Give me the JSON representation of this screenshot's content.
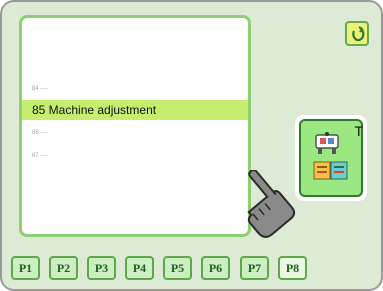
{
  "list": {
    "rows": [
      {
        "label": "84 ----"
      },
      {
        "label": "85 Machine adjustment"
      },
      {
        "label": "86 ----"
      },
      {
        "label": "87 ----"
      }
    ]
  },
  "machine_adjust_button": {
    "badge": "T"
  },
  "pages": [
    "P1",
    "P2",
    "P3",
    "P4",
    "P5",
    "P6",
    "P7",
    "P8"
  ],
  "colors": {
    "selected_row": "#c6ee6e",
    "panel_border": "#8fcf74",
    "button_fill": "#9be882"
  }
}
